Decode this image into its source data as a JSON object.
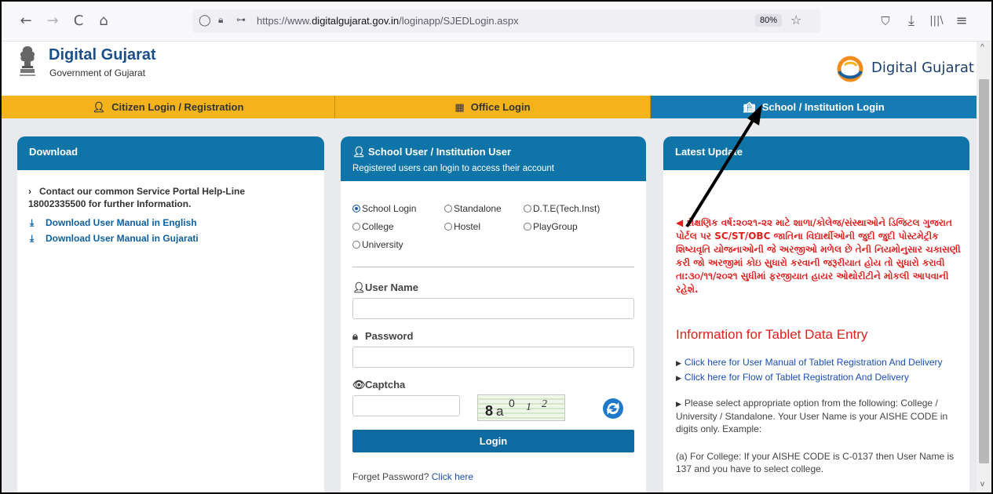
{
  "browser": {
    "back": "←",
    "forward": "→",
    "reload": "C",
    "home": "⌂",
    "shield": "◯",
    "lock": "🔒︎",
    "perm": "⊶",
    "url_prefix": "https://www.",
    "url_domain": "digitalgujarat.gov.in",
    "url_path": "/loginapp/SJEDLogin.aspx",
    "zoom": "80%",
    "star": "☆",
    "pocket": "⛉",
    "download": "⤓",
    "library": "|||\\",
    "menu": "≡"
  },
  "header": {
    "title": "Digital Gujarat",
    "subtitle": "Government of Gujarat",
    "logo_text": "Digital Gujarat"
  },
  "nav": {
    "tabs": [
      {
        "icon": "👤︎",
        "label": "Citizen Login / Registration"
      },
      {
        "icon": "▦",
        "label": "Office Login"
      },
      {
        "icon": "🏫︎",
        "label": "School / Institution Login"
      }
    ]
  },
  "download": {
    "title": "Download",
    "helpline": "Contact our common Service Portal Help-Line 18002335500 for further Information.",
    "links": [
      "Download User Manual in English",
      "Download User Manual in Gujarati"
    ]
  },
  "login": {
    "title": "School User / Institution User",
    "subtitle": "Registered users can login to access their account",
    "options": [
      "School Login",
      "Standalone",
      "D.T.E(Tech.Inst)",
      "College",
      "Hostel",
      "PlayGroup",
      "University"
    ],
    "selected": "School Login",
    "username_label": "User Name",
    "password_label": "Password",
    "captcha_label": "Captcha",
    "captcha_text": "8a0 1 2",
    "login_button": "Login",
    "forgot_text": "Forget Password?",
    "forgot_link": "Click here"
  },
  "updates": {
    "title": "Latest Update",
    "gujarati": "શૈક્ષણિક વર્ષ:૨૦૨૧-૨૨ માટે શાળા/કોલેજ/સંસ્થાઓને ડિજિટલ ગુજરાત પોર્ટલ પર SC/ST/OBC જાતિના વિદ્યાર્થીઓની જુદી જુદી પોસ્ટમેટ્રીક શિષ્યવૃતિ યોજનાઓની જે અરજીઓ મળેલ છે તેની નિયમોનુસાર ચકાસણી કરી જો અરજીમાં કોઇ સુધારો કરવાની જરૂરીયાત હોય તો સુધારો કરાવી તા:૩૦/૧૧/૨૦૨૧ સુધીમાં ફરજીયાત હાયર ઓથોરીટીને મોકલી આપવાની રહેશે.",
    "tablet_title": "Information for Tablet Data Entry",
    "links": [
      "Click here for User Manual of Tablet Registration And Delivery",
      "Click here for Flow of Tablet Registration And Delivery"
    ],
    "instruction": "Please select appropriate option from the following: College / University / Standalone. Your User Name is your AISHE CODE in digits only. Example:",
    "example": "(a) For College: If your AISHE CODE is C-0137 then User Name is 137 and you have to select college."
  }
}
